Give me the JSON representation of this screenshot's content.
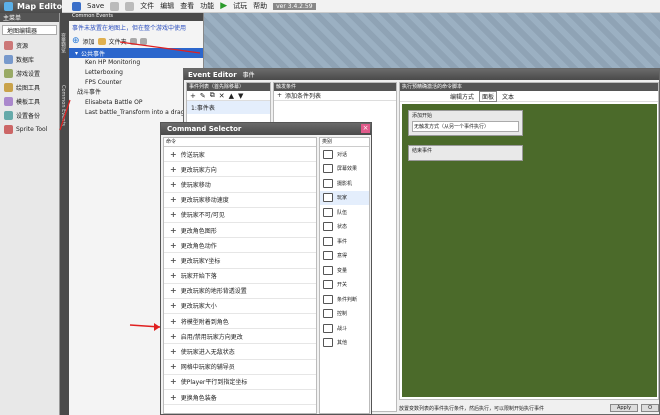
{
  "app": {
    "title": "Map Editor",
    "toolbar": {
      "save": "Save",
      "menu": [
        "文件",
        "编辑",
        "查看",
        "功能"
      ],
      "test": "试玩",
      "help": "帮助",
      "version": "ver 3.4.2.59"
    }
  },
  "left_panel": {
    "header": "主菜单",
    "tab_label": "地图编辑器",
    "items": [
      "资源",
      "数据库",
      "游戏设置",
      "绘图工具",
      "模板工具",
      "设置备份",
      "Sprite Tool"
    ]
  },
  "vertical_tabs": [
    "变量预览",
    "Common Events"
  ],
  "common_events": {
    "title": "Common Events",
    "hint": "事件未放置在地图上，但在整个游戏中使用",
    "add_label": "添加",
    "folder_label": "文件夹",
    "public_folder": "公共事件",
    "items": [
      "Ken HP Monitoring",
      "Letterboxing",
      "FPS Counter"
    ],
    "battle_folder": "战斗事件",
    "battle_items": [
      "Elisabeta Battle OP",
      "Last battle_Transform into a drago"
    ]
  },
  "event_editor": {
    "title": "Event Editor",
    "tab": "事件",
    "list_header": "事件列表（首先除移幕）",
    "list_item": "1:事件表",
    "trigger_header": "触发条件",
    "add_trigger": "添加条件列表",
    "script_header": "执行预精确激活的命令脚本",
    "toolbar": {
      "btn1": "编辑方式",
      "btn2": "面板",
      "btn3": "文本"
    },
    "node1_title": "添加开始",
    "node1_value": "无触发方式（从另一个事件执行）",
    "node2_title": "结束事件",
    "status": "放置变数列表的事件执行条件，然后执行，可以限制开始执行事件",
    "apply": "Apply",
    "ok": "O"
  },
  "command_selector": {
    "title": "Command Selector",
    "left_header": "命令",
    "right_header": "类别",
    "commands": [
      "传送玩家",
      "更改玩家方向",
      "使玩家移动",
      "更改玩家移动速度",
      "使玩家不可/可见",
      "更改角色图形",
      "更改角色动作",
      "更改玩家Y坐标",
      "玩家开始下落",
      "更改玩家的地形背透设置",
      "更改玩家大小",
      "将模型附着到角色",
      "启用/禁用玩家方向更改",
      "使玩家进入无敌状态",
      "网格中玩家的辅导员",
      "使Player平行到指定坐标",
      "更换角色装备"
    ],
    "categories": [
      "对话",
      "屏幕效果",
      "摄影机",
      "玩家",
      "队伍",
      "状态",
      "事件",
      "意得",
      "变量",
      "开关",
      "条件判断",
      "控制",
      "战斗",
      "其他"
    ]
  }
}
